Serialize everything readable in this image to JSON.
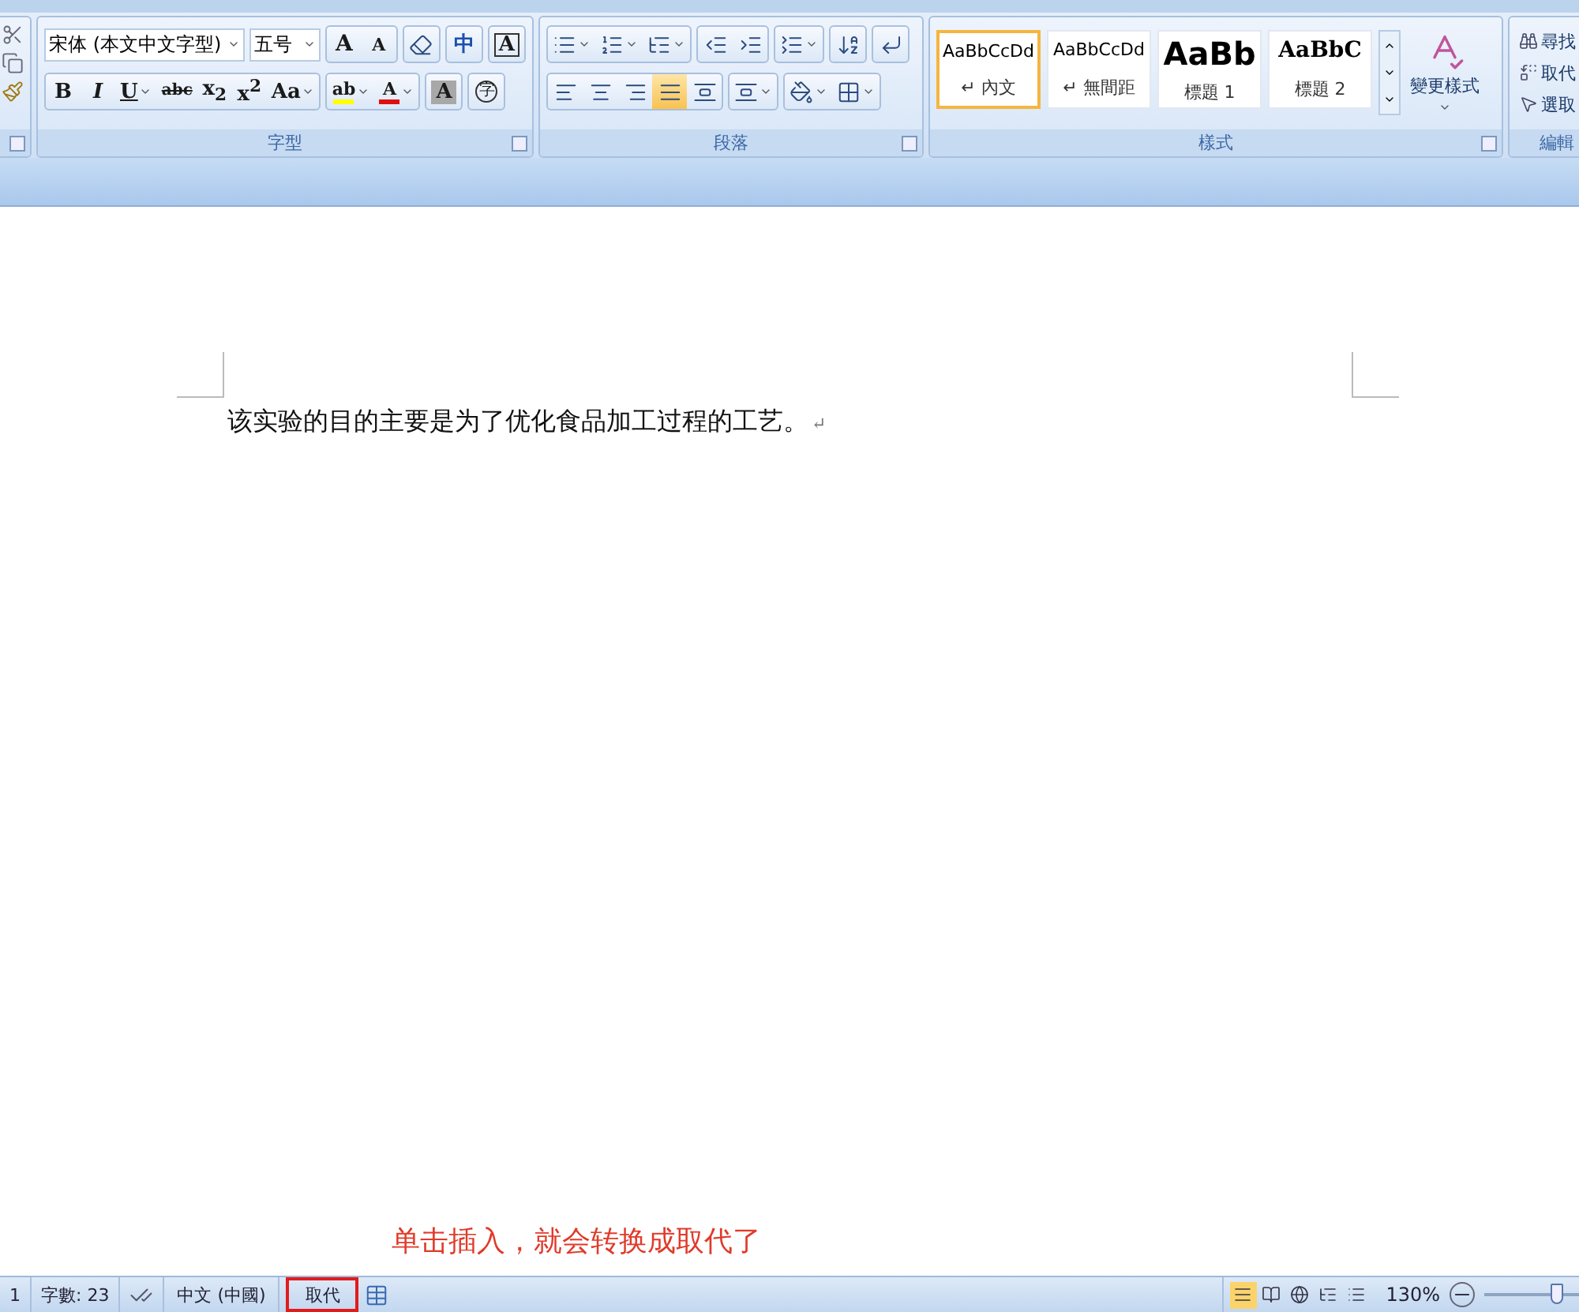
{
  "ribbon": {
    "font_group": {
      "label": "字型",
      "font_name": "宋体 (本文中文字型)",
      "font_size": "五号",
      "row1_buttons": [
        {
          "label": "A",
          "kind": "grow"
        },
        {
          "label": "A",
          "kind": "shrink"
        },
        {
          "kind": "eraser"
        },
        {
          "label": "中",
          "kind": "phonetic"
        },
        {
          "label": "A",
          "kind": "boxed"
        }
      ],
      "row2_buttons": [
        {
          "label": "B",
          "kind": "bold",
          "dropdown": false
        },
        {
          "label": "I",
          "kind": "italic",
          "dropdown": false
        },
        {
          "label": "U",
          "kind": "underline",
          "dropdown": true
        },
        {
          "label": "abc",
          "kind": "strike",
          "dropdown": false
        },
        {
          "label": "x$_{2}$",
          "kind": "script",
          "dropdown": false
        },
        {
          "label": "x$^{2}$",
          "kind": "script",
          "dropdown": false
        },
        {
          "label": "Aa",
          "kind": "plain",
          "dropdown": true
        },
        {
          "label": "ab",
          "kind": "highlight",
          "dropdown": true,
          "color": "#ffff00"
        },
        {
          "label": "A",
          "kind": "fontcolor",
          "dropdown": true,
          "color": "#e01010"
        },
        {
          "label": "A",
          "kind": "shaded",
          "dropdown": false
        },
        {
          "label": "字",
          "kind": "circled",
          "dropdown": false
        }
      ]
    },
    "paragraph_group": {
      "label": "段落",
      "align_buttons": [
        {
          "selected": false
        },
        {
          "selected": false
        },
        {
          "selected": false
        },
        {
          "selected": true
        },
        {
          "selected": false
        }
      ]
    },
    "styles_group": {
      "label": "樣式",
      "change_styles": "變更樣式",
      "styles": [
        {
          "preview": "AaBbCcDd",
          "name": "內文",
          "mark": "↵",
          "kind": "normal",
          "selected": true
        },
        {
          "preview": "AaBbCcDd",
          "name": "無間距",
          "mark": "↵",
          "kind": "normal",
          "selected": false
        },
        {
          "preview": "AaBb",
          "name": "標題 1",
          "kind": "heading1",
          "selected": false
        },
        {
          "preview": "AaBbC",
          "name": "標題 2",
          "kind": "heading2",
          "selected": false
        }
      ]
    },
    "editing_group": {
      "label": "編輯",
      "items": [
        "尋找",
        "取代",
        "選取"
      ]
    }
  },
  "document": {
    "text": "该实验的目的主要是为了优化食品加工过程的工艺。",
    "mark": "↵"
  },
  "annotation": {
    "text": "单击插入，就会转换成取代了"
  },
  "status_bar": {
    "page": "1",
    "words": "字數: 23",
    "language": "中文 (中國)",
    "mode": "取代",
    "mode_boxed": true,
    "views": [
      {
        "selected": true
      },
      {
        "selected": false
      },
      {
        "selected": false
      },
      {
        "selected": false
      },
      {
        "selected": false
      }
    ],
    "zoom": "130%",
    "zoom_slider": {
      "level": 0.77
    }
  }
}
